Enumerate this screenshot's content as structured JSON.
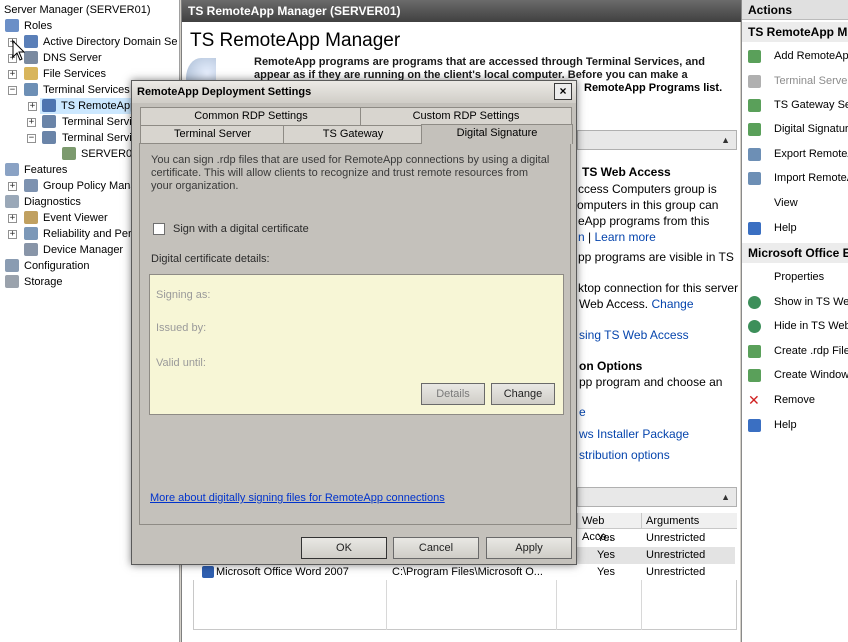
{
  "tree": {
    "items": [
      {
        "label": "Server Manager (SERVER01)"
      },
      {
        "label": "Roles"
      },
      {
        "label": "Active Directory Domain Se"
      },
      {
        "label": "DNS Server"
      },
      {
        "label": "File Services"
      },
      {
        "label": "Terminal Services"
      },
      {
        "label": "TS RemoteApp"
      },
      {
        "label": "Terminal Servi"
      },
      {
        "label": "Terminal Servi"
      },
      {
        "label": "SERVER01"
      },
      {
        "label": "Features"
      },
      {
        "label": "Group Policy Mana"
      },
      {
        "label": "Diagnostics"
      },
      {
        "label": "Event Viewer"
      },
      {
        "label": "Reliability and Per"
      },
      {
        "label": "Device Manager"
      },
      {
        "label": "Configuration"
      },
      {
        "label": "Storage"
      }
    ]
  },
  "center": {
    "header": "TS RemoteApp Manager (SERVER01)",
    "title": "TS RemoteApp Manager",
    "intro": "RemoteApp programs are programs that are accessed through Terminal Services, and appear as if they are running on the client's local computer. Before you can make a",
    "intro_tail": "RemoteApp Programs list.",
    "web_access": {
      "heading": "TS Web Access",
      "line1": "ccess Computers group is",
      "line2": "omputers in this group can",
      "line3": "eApp programs from this",
      "line4_link1": "n",
      "line4_sep": " | ",
      "line4_link2": "Learn more",
      "line5": "pp programs are visible in TS",
      "line6": "ktop connection for this server",
      "line7_text": "Web Access.",
      "line7_link": "Change",
      "line8_link": "sing TS Web Access"
    },
    "options": {
      "heading": "on Options",
      "line1": "pp program and choose an",
      "line2_link": "e",
      "line3_link": "ws Installer Package",
      "line4_link": "stribution options"
    },
    "table": {
      "columns": [
        "Web Acce...",
        "Arguments"
      ],
      "rows": [
        {
          "name": "",
          "path": "",
          "web": "Yes",
          "args": "Unrestricted"
        },
        {
          "name": "",
          "path": "",
          "web": "Yes",
          "args": "Unrestricted"
        },
        {
          "name": "Microsoft Office Word 2007",
          "path": "C:\\Program Files\\Microsoft O...",
          "web": "Yes",
          "args": "Unrestricted"
        }
      ]
    }
  },
  "actions": {
    "header": "Actions",
    "section1": "TS RemoteApp M",
    "items1": [
      {
        "label": "Add RemoteAp",
        "icon": "add-icon",
        "disabled": false
      },
      {
        "label": "Terminal Server",
        "icon": "server-icon",
        "disabled": true
      },
      {
        "label": "TS Gateway Se",
        "icon": "gateway-icon",
        "disabled": false
      },
      {
        "label": "Digital Signature",
        "icon": "signature-icon",
        "disabled": false
      },
      {
        "label": "Export RemoteA",
        "icon": "export-icon",
        "disabled": false
      },
      {
        "label": "Import RemoteA",
        "icon": "import-icon",
        "disabled": false
      },
      {
        "label": "View",
        "icon": "view-icon",
        "disabled": false
      },
      {
        "label": "Help",
        "icon": "help-icon",
        "disabled": false
      }
    ],
    "section2": "Microsoft Office E",
    "items2": [
      {
        "label": "Properties",
        "icon": "properties-icon"
      },
      {
        "label": "Show in TS We",
        "icon": "show-icon"
      },
      {
        "label": "Hide in TS Web",
        "icon": "hide-icon"
      },
      {
        "label": "Create .rdp File",
        "icon": "rdp-icon"
      },
      {
        "label": "Create Window",
        "icon": "create-icon"
      },
      {
        "label": "Remove",
        "icon": "remove-icon"
      },
      {
        "label": "Help",
        "icon": "help-icon"
      }
    ]
  },
  "dialog": {
    "title": "RemoteApp Deployment Settings",
    "close": "×",
    "tabs_top": [
      "Common RDP Settings",
      "Custom RDP Settings"
    ],
    "tabs_bottom": [
      "Terminal Server",
      "TS Gateway",
      "Digital Signature"
    ],
    "description": "You can sign .rdp files that are used for RemoteApp connections by using a digital certificate. This will allow clients to recognize and trust remote resources from your organization.",
    "checkbox_label": "Sign with a digital certificate",
    "details_label": "Digital certificate details:",
    "cert": {
      "signing_as": "Signing as:",
      "issued_by": "Issued by:",
      "valid_until": "Valid until:"
    },
    "details_button": "Details",
    "change_button": "Change",
    "link": "More about digitally signing files for RemoteApp connections",
    "ok": "OK",
    "cancel": "Cancel",
    "apply": "Apply"
  },
  "colors": {
    "link": "#0645ad",
    "cert_bg": "#f7f6d6",
    "dialog_bg": "#c4c1bb"
  }
}
